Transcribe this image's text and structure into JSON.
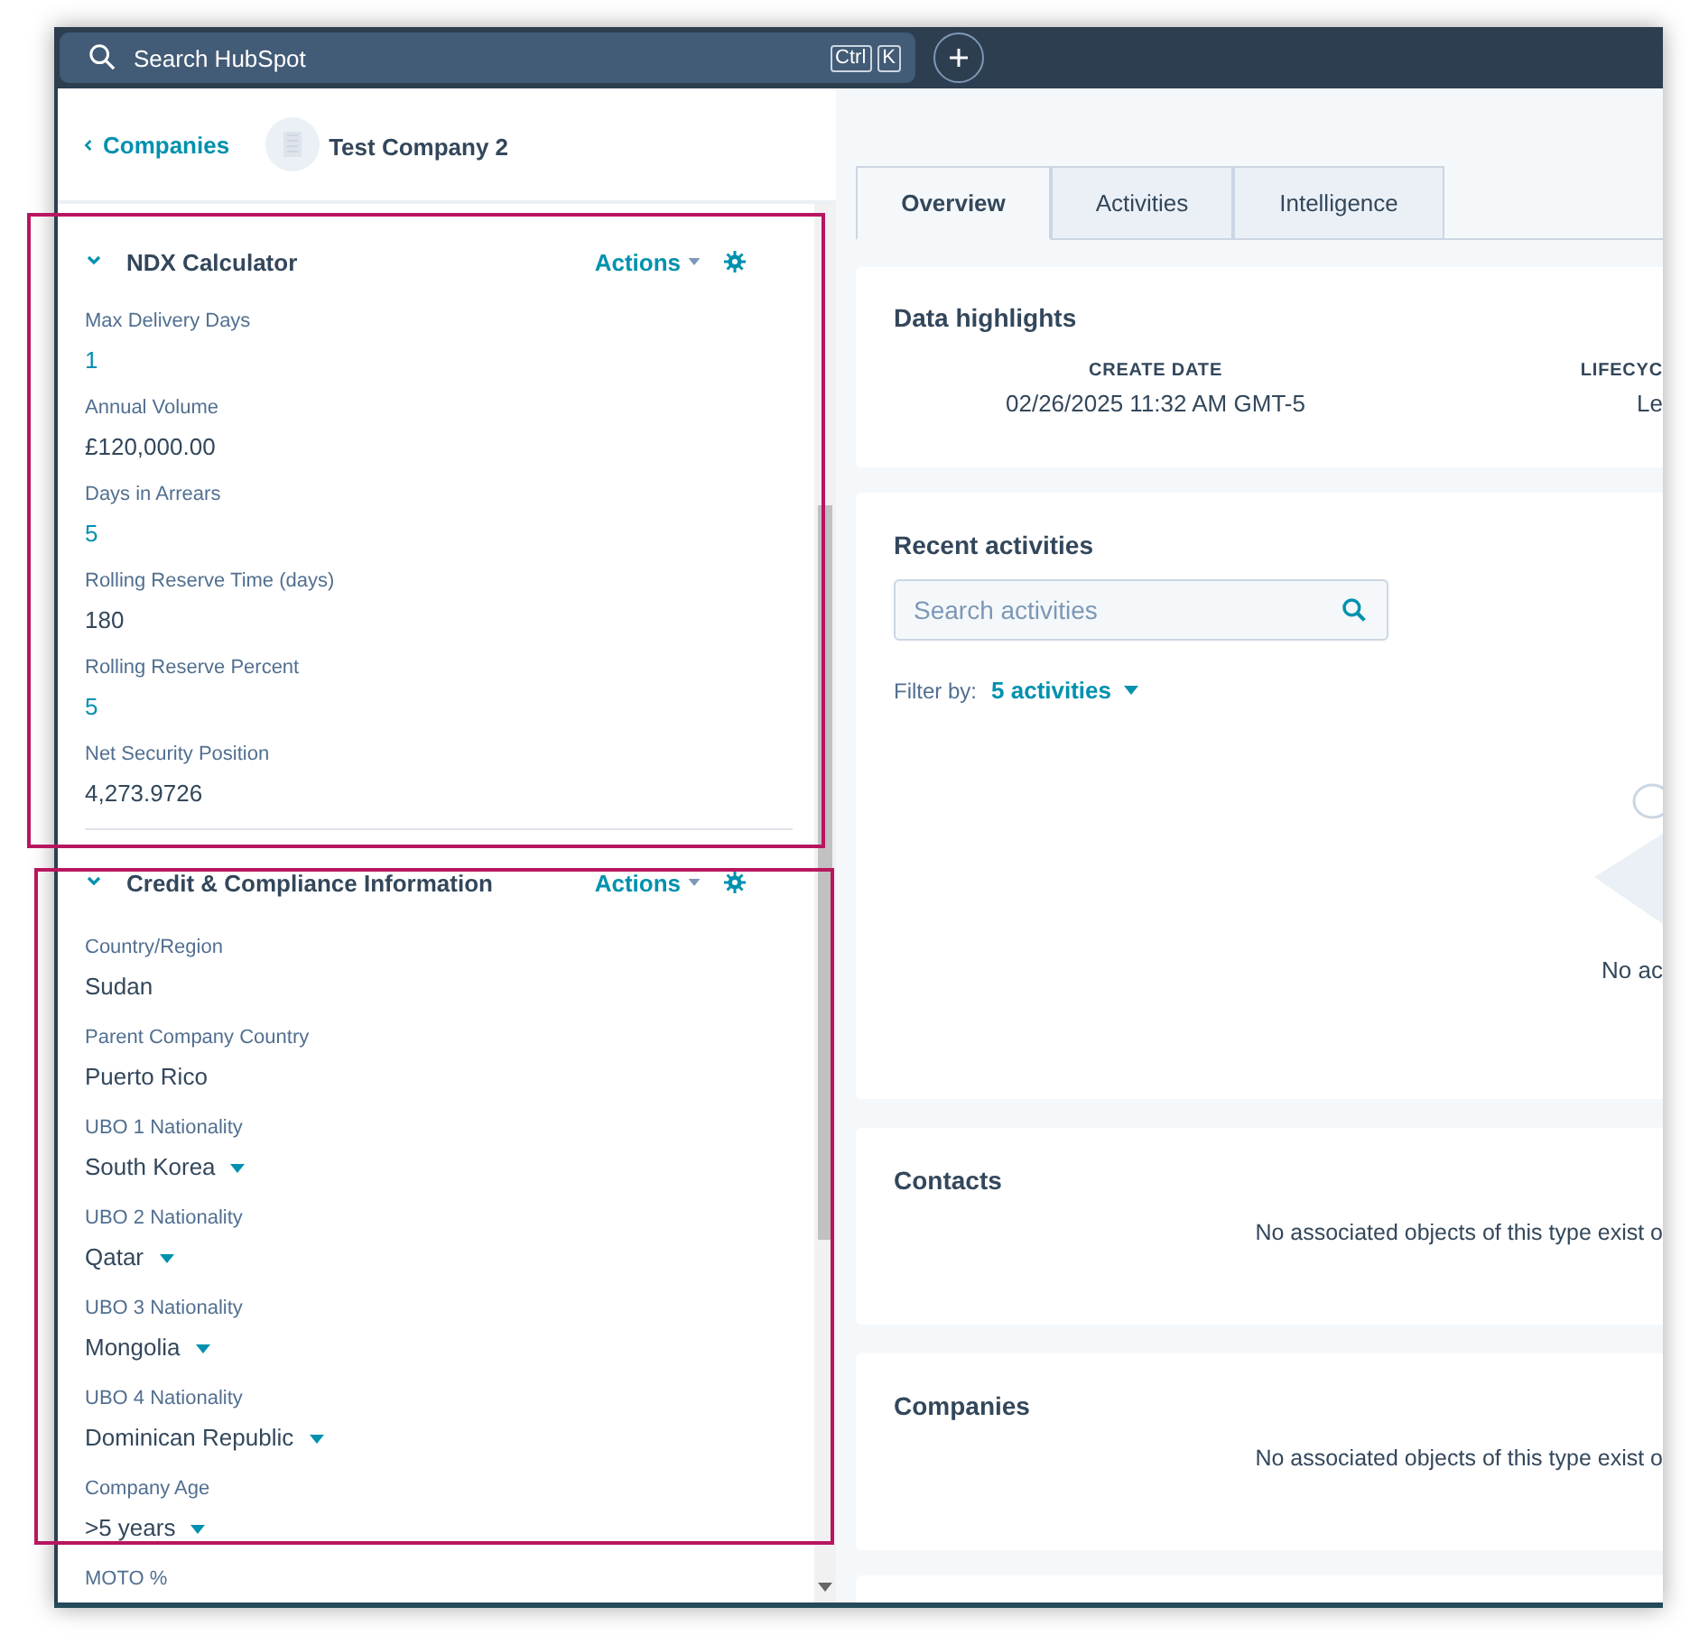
{
  "top_bar": {
    "search": {
      "placeholder": "Search HubSpot"
    },
    "shortcut_keys": [
      "Ctrl",
      "K"
    ]
  },
  "record": {
    "back_link": "Companies",
    "name": "Test Company 2"
  },
  "sections": [
    {
      "title": "NDX Calculator",
      "expanded": true,
      "actions_label": "Actions",
      "fields": [
        {
          "label": "Max Delivery Days",
          "value": "1",
          "kind": "link"
        },
        {
          "label": "Annual Volume",
          "value": "£120,000.00",
          "kind": "text"
        },
        {
          "label": "Days in Arrears",
          "value": "5",
          "kind": "link"
        },
        {
          "label": "Rolling Reserve Time (days)",
          "value": "180",
          "kind": "text"
        },
        {
          "label": "Rolling Reserve Percent",
          "value": "5",
          "kind": "link"
        },
        {
          "label": "Net Security Position",
          "value": "4,273.9726",
          "kind": "text"
        }
      ]
    },
    {
      "title": "Credit & Compliance Information",
      "expanded": true,
      "actions_label": "Actions",
      "fields": [
        {
          "label": "Country/Region",
          "value": "Sudan",
          "kind": "text"
        },
        {
          "label": "Parent Company Country",
          "value": "Puerto Rico",
          "kind": "text"
        },
        {
          "label": "UBO 1 Nationality",
          "value": "South Korea",
          "kind": "select"
        },
        {
          "label": "UBO 2 Nationality",
          "value": "Qatar",
          "kind": "select"
        },
        {
          "label": "UBO 3 Nationality",
          "value": "Mongolia",
          "kind": "select"
        },
        {
          "label": "UBO 4 Nationality",
          "value": "Dominican Republic",
          "kind": "select"
        },
        {
          "label": "Company Age",
          "value": ">5 years",
          "kind": "select"
        },
        {
          "label": "MOTO %"
        }
      ]
    }
  ],
  "tabs": [
    {
      "label": "Overview",
      "selected": true
    },
    {
      "label": "Activities",
      "selected": false
    },
    {
      "label": "Intelligence",
      "selected": false
    }
  ],
  "data_highlights": {
    "title": "Data highlights",
    "items": [
      {
        "label": "CREATE DATE",
        "value": "02/26/2025 11:32 AM GMT-5"
      },
      {
        "label": "LIFECYC",
        "value": "Le"
      }
    ]
  },
  "recent_activities": {
    "title": "Recent activities",
    "search": {
      "placeholder": "Search activities"
    },
    "filter_label": "Filter by:",
    "filter_value": "5 activities",
    "empty_text": "No ac"
  },
  "association_cards": [
    {
      "title": "Contacts",
      "empty_text": "No associated objects of this type exist o"
    },
    {
      "title": "Companies",
      "empty_text": "No associated objects of this type exist o"
    }
  ]
}
